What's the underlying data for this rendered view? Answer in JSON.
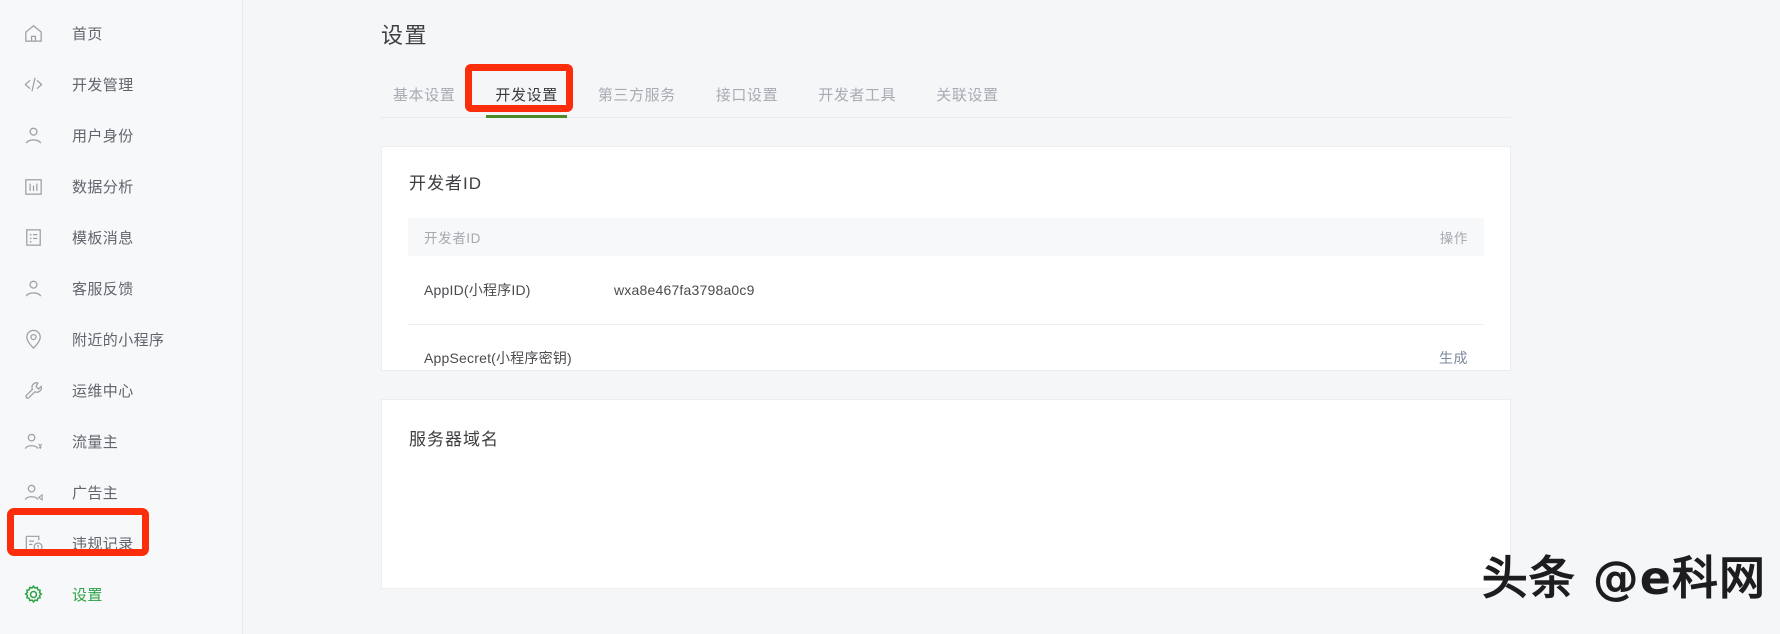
{
  "sidebar": {
    "items": [
      {
        "label": "首页",
        "icon": "home-icon",
        "active": false
      },
      {
        "label": "开发管理",
        "icon": "code-icon",
        "active": false
      },
      {
        "label": "用户身份",
        "icon": "user-icon",
        "active": false
      },
      {
        "label": "数据分析",
        "icon": "chart-bar-icon",
        "active": false
      },
      {
        "label": "模板消息",
        "icon": "document-icon",
        "active": false
      },
      {
        "label": "客服反馈",
        "icon": "user-icon",
        "active": false
      },
      {
        "label": "附近的小程序",
        "icon": "location-pin-icon",
        "active": false
      },
      {
        "label": "运维中心",
        "icon": "wrench-icon",
        "active": false
      },
      {
        "label": "流量主",
        "icon": "user-yuan-icon",
        "active": false
      },
      {
        "label": "广告主",
        "icon": "user-ad-icon",
        "active": false
      },
      {
        "label": "违规记录",
        "icon": "record-alert-icon",
        "active": false
      },
      {
        "label": "设置",
        "icon": "gear-icon",
        "active": true
      }
    ]
  },
  "header": {
    "title": "设置"
  },
  "tabs": [
    {
      "label": "基本设置",
      "active": false
    },
    {
      "label": "开发设置",
      "active": true
    },
    {
      "label": "第三方服务",
      "active": false
    },
    {
      "label": "接口设置",
      "active": false
    },
    {
      "label": "开发者工具",
      "active": false
    },
    {
      "label": "关联设置",
      "active": false
    }
  ],
  "developer_id_card": {
    "title": "开发者ID",
    "columns": {
      "name": "开发者ID",
      "action": "操作"
    },
    "rows": [
      {
        "name": "AppID(小程序ID)",
        "value": "wxa8e467fa3798a0c9",
        "action": ""
      },
      {
        "name": "AppSecret(小程序密钥)",
        "value": "",
        "action": "生成"
      }
    ]
  },
  "server_domain_card": {
    "title": "服务器域名"
  },
  "watermark": {
    "text": "头条 @e科网"
  },
  "colors": {
    "accent_green": "#2ba245",
    "tab_underline_green": "#4a8c27",
    "annotation_red": "#fb2d0a",
    "link_gray_blue": "#7d879c",
    "page_background": "#f5f6f8",
    "card_background": "#ffffff"
  }
}
